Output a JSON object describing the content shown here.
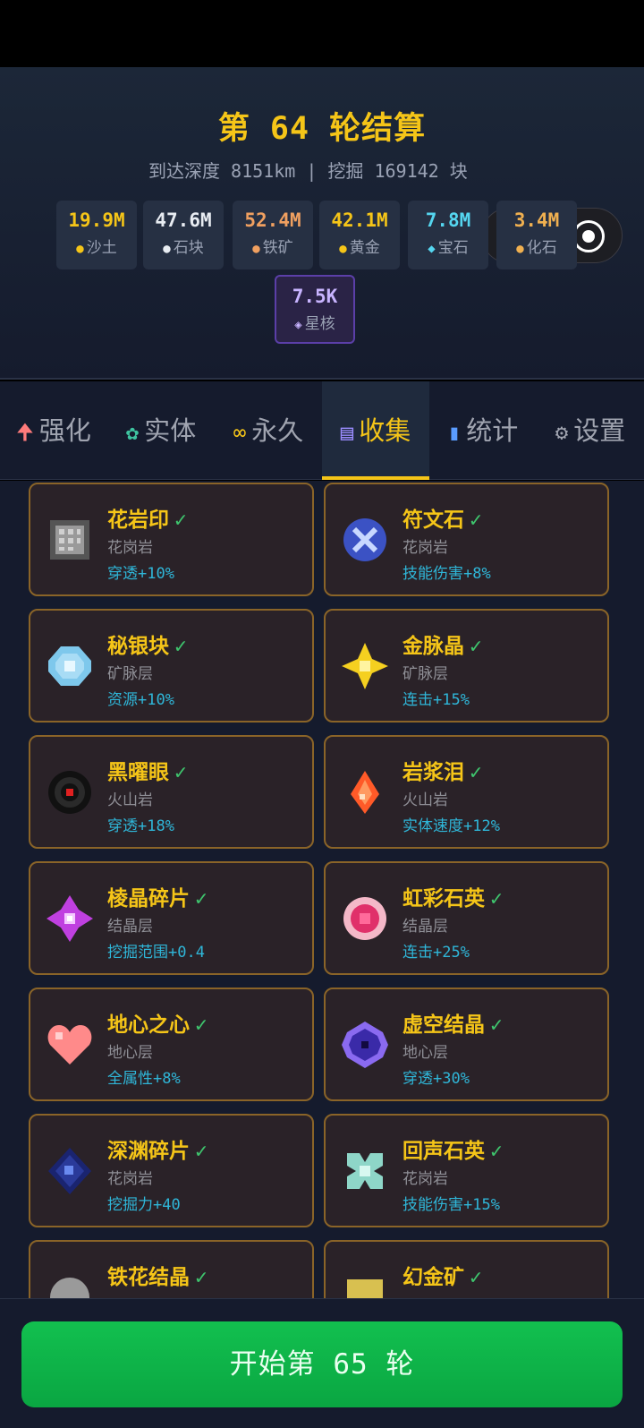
{
  "header": {
    "title": "第 64 轮结算",
    "subtitle": "到达深度 8151km | 挖掘 169142 块"
  },
  "resources": [
    {
      "value": "19.9M",
      "label": "沙土",
      "color": "#f5c518",
      "icon": "sand-icon"
    },
    {
      "value": "47.6M",
      "label": "石块",
      "color": "#e8ecf2",
      "icon": "stone-icon"
    },
    {
      "value": "52.4M",
      "label": "铁矿",
      "color": "#f0a060",
      "icon": "iron-ore-icon"
    },
    {
      "value": "42.1M",
      "label": "黄金",
      "color": "#f5c518",
      "icon": "gold-icon"
    },
    {
      "value": "7.8M",
      "label": "宝石",
      "color": "#55d6f0",
      "icon": "gem-icon"
    },
    {
      "value": "3.4M",
      "label": "化石",
      "color": "#f0b050",
      "icon": "fossil-icon"
    },
    {
      "value": "7.5K",
      "label": "星核",
      "color": "#c8b4ff",
      "icon": "star-core-icon"
    }
  ],
  "tabs": [
    {
      "label": "强化",
      "icon": "arrow-up-icon",
      "glyph": "🠉",
      "color": "#ff7b7b"
    },
    {
      "label": "实体",
      "icon": "gear-green-icon",
      "glyph": "✿",
      "color": "#3ec4a0"
    },
    {
      "label": "永久",
      "icon": "infinity-icon",
      "glyph": "∞",
      "color": "#f5c518"
    },
    {
      "label": "收集",
      "icon": "list-icon",
      "glyph": "▤",
      "color": "#9b8cff"
    },
    {
      "label": "统计",
      "icon": "bar-chart-icon",
      "glyph": "▮",
      "color": "#5a9cff"
    },
    {
      "label": "设置",
      "icon": "settings-icon",
      "glyph": "⚙",
      "color": "#a0a4b0"
    }
  ],
  "active_tab": "收集",
  "collection": [
    {
      "name": "花岩印",
      "check": "✓",
      "layer": "花岗岩",
      "bonus": "穿透+10%",
      "icon": "granite-seal-icon",
      "color": "#8a8a8a"
    },
    {
      "name": "符文石",
      "check": "✓",
      "layer": "花岗岩",
      "bonus": "技能伤害+8%",
      "icon": "rune-stone-icon",
      "color": "#3b52c4"
    },
    {
      "name": "秘银块",
      "check": "✓",
      "layer": "矿脉层",
      "bonus": "资源+10%",
      "icon": "mithril-block-icon",
      "color": "#a8dcf5"
    },
    {
      "name": "金脉晶",
      "check": "✓",
      "layer": "矿脉层",
      "bonus": "连击+15%",
      "icon": "gold-vein-crystal-icon",
      "color": "#f5d020"
    },
    {
      "name": "黑曜眼",
      "check": "✓",
      "layer": "火山岩",
      "bonus": "穿透+18%",
      "icon": "obsidian-eye-icon",
      "color": "#1a1a1a"
    },
    {
      "name": "岩浆泪",
      "check": "✓",
      "layer": "火山岩",
      "bonus": "实体速度+12%",
      "icon": "magma-tear-icon",
      "color": "#ff5a28"
    },
    {
      "name": "棱晶碎片",
      "check": "✓",
      "layer": "结晶层",
      "bonus": "挖掘范围+0.4",
      "icon": "prism-shard-icon",
      "color": "#c040e0"
    },
    {
      "name": "虹彩石英",
      "check": "✓",
      "layer": "结晶层",
      "bonus": "连击+25%",
      "icon": "iridescent-quartz-icon",
      "color": "#e0306a"
    },
    {
      "name": "地心之心",
      "check": "✓",
      "layer": "地心层",
      "bonus": "全属性+8%",
      "icon": "earth-heart-icon",
      "color": "#ff8a8a"
    },
    {
      "name": "虚空结晶",
      "check": "✓",
      "layer": "地心层",
      "bonus": "穿透+30%",
      "icon": "void-crystal-icon",
      "color": "#3a2aa8"
    },
    {
      "name": "深渊碎片",
      "check": "✓",
      "layer": "花岗岩",
      "bonus": "挖掘力+40",
      "icon": "abyss-shard-icon",
      "color": "#2a3a9a"
    },
    {
      "name": "回声石英",
      "check": "✓",
      "layer": "花岗岩",
      "bonus": "技能伤害+15%",
      "icon": "echo-quartz-icon",
      "color": "#8ed6c8"
    },
    {
      "name": "铁花结晶",
      "check": "✓",
      "layer": "",
      "bonus": "",
      "icon": "iron-flower-crystal-icon",
      "color": "#9a9a9a"
    },
    {
      "name": "幻金矿",
      "check": "✓",
      "layer": "",
      "bonus": "",
      "icon": "phantom-gold-ore-icon",
      "color": "#d8c050"
    }
  ],
  "footer": {
    "start_label": "开始第 65 轮"
  }
}
